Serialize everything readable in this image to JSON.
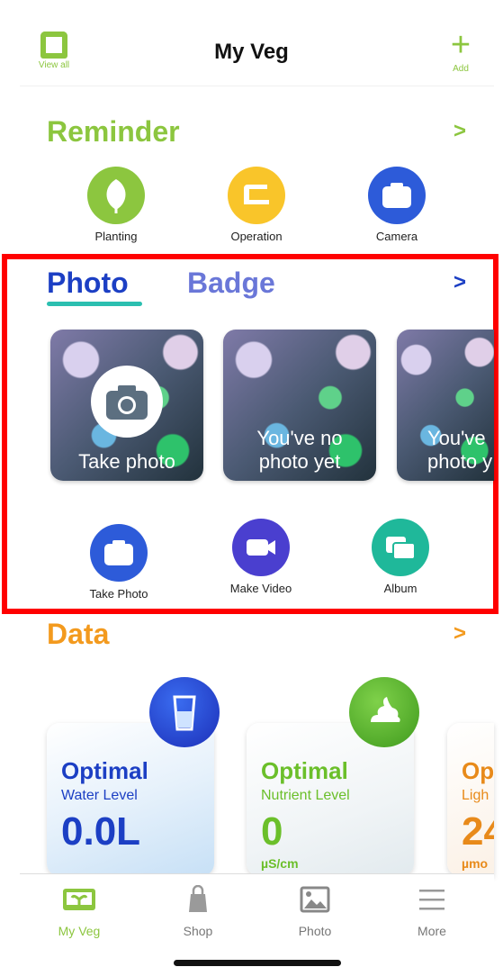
{
  "header": {
    "title": "My Veg",
    "view_all_label": "View all",
    "add_label": "Add"
  },
  "reminder": {
    "title": "Reminder",
    "items": [
      {
        "label": "Planting",
        "icon": "leaf-icon",
        "color": "#8cc63f"
      },
      {
        "label": "Operation",
        "icon": "tray-icon",
        "color": "#f9c52a"
      },
      {
        "label": "Camera",
        "icon": "camera-icon",
        "color": "#2d5bd9"
      }
    ]
  },
  "photo_section": {
    "tabs": [
      {
        "label": "Photo",
        "active": true
      },
      {
        "label": "Badge",
        "active": false
      }
    ],
    "cards": [
      {
        "text": "Take photo"
      },
      {
        "text_line1": "You've no",
        "text_line2": "photo yet"
      },
      {
        "text_line1": "You've",
        "text_line2": "photo y"
      }
    ],
    "actions": [
      {
        "label": "Take Photo",
        "icon": "camera-icon",
        "color": "#2d5bd9"
      },
      {
        "label": "Make Video",
        "icon": "video-icon",
        "color": "#4a3fcf"
      },
      {
        "label": "Album",
        "icon": "album-icon",
        "color": "#1fb89a"
      }
    ]
  },
  "data_section": {
    "title": "Data",
    "cards": [
      {
        "status": "Optimal",
        "label": "Water Level",
        "value": "0.0L",
        "unit": "",
        "color": "#1c3fc4"
      },
      {
        "status": "Optimal",
        "label": "Nutrient Level",
        "value": "0",
        "unit": "µS/cm",
        "color": "#6bbf2a"
      },
      {
        "status": "Op",
        "label": "Ligh",
        "value": "24",
        "unit": "µmo",
        "color": "#e88a1a"
      }
    ]
  },
  "bottom_nav": [
    {
      "label": "My Veg",
      "active": true
    },
    {
      "label": "Shop",
      "active": false
    },
    {
      "label": "Photo",
      "active": false
    },
    {
      "label": "More",
      "active": false
    }
  ],
  "colors": {
    "green": "#8cc63f",
    "orange": "#f39a1e",
    "blue": "#1c3fc4",
    "badge_blue": "#6a77d8",
    "tab_underline": "#2bbfb0"
  }
}
